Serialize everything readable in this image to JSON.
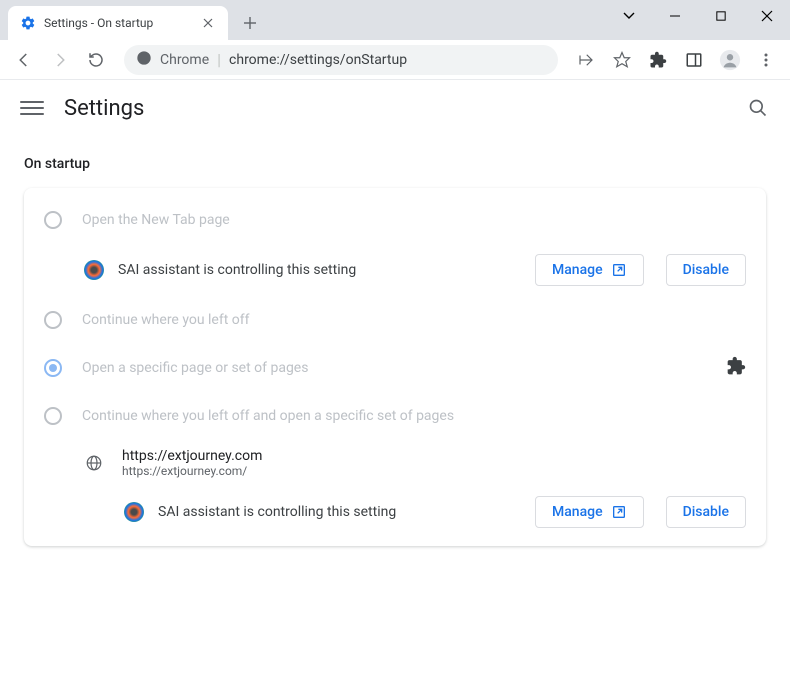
{
  "window": {
    "tabTitle": "Settings - On startup"
  },
  "omnibox": {
    "scheme": "Chrome",
    "path": "chrome://settings/onStartup"
  },
  "settings": {
    "title": "Settings",
    "sectionTitle": "On startup",
    "options": {
      "newTab": "Open the New Tab page",
      "continue": "Continue where you left off",
      "specific": "Open a specific page or set of pages",
      "continueSpecific": "Continue where you left off and open a specific set of pages"
    },
    "controlled": {
      "text": "SAI assistant is controlling this setting",
      "manage": "Manage",
      "disable": "Disable"
    },
    "page": {
      "url": "https://extjourney.com",
      "urlFull": "https://extjourney.com/"
    }
  }
}
